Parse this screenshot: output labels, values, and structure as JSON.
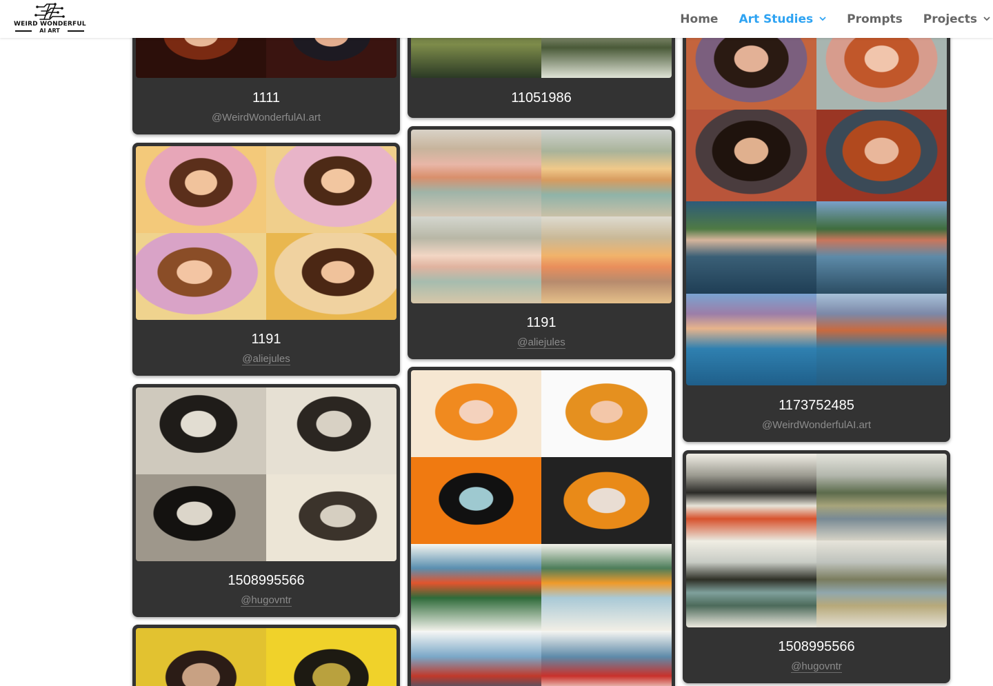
{
  "logo": {
    "line1": "WEIRD WONDERFUL",
    "line2": "AI ART"
  },
  "nav": {
    "items": [
      {
        "label": "Home",
        "active": false,
        "dropdown": false
      },
      {
        "label": "Art Studies",
        "active": true,
        "dropdown": true
      },
      {
        "label": "Prompts",
        "active": false,
        "dropdown": false
      },
      {
        "label": "Projects",
        "active": false,
        "dropdown": true
      }
    ],
    "active_color": "#2ea3f2",
    "text_color": "#666666"
  },
  "cards": [
    {
      "title": "1111",
      "credit": "@WeirdWonderfulAI.art",
      "image": "red-haired-portraits-grid"
    },
    {
      "title": "11051986",
      "credit": "",
      "image": "forest-landscape-grid"
    },
    {
      "title": "1191",
      "credit": "@aliejules",
      "image": "pink-wallpaper-portraits-grid"
    },
    {
      "title": "1191",
      "credit": "@aliejules",
      "image": "pastel-palace-lake-grid"
    },
    {
      "title": "1508995566",
      "credit": "@hugovntr",
      "image": "vintage-bw-portraits-grid"
    },
    {
      "title": "",
      "credit": "",
      "image": "orange-illustrated-portraits-and-chinese-landscapes-grid"
    },
    {
      "title": "1173752485",
      "credit": "@WeirdWonderfulAI.art",
      "image": "oil-portraits-and-lake-landscapes-grid"
    },
    {
      "title": "1508995566",
      "credit": "@hugovntr",
      "image": "ink-wash-mountain-landscapes-grid"
    },
    {
      "title": "",
      "credit": "",
      "image": "yellow-pop-portraits-grid"
    }
  ],
  "colors": {
    "card_bg": "#333333",
    "card_title": "#ffffff",
    "card_credit": "#8c8c8c"
  }
}
